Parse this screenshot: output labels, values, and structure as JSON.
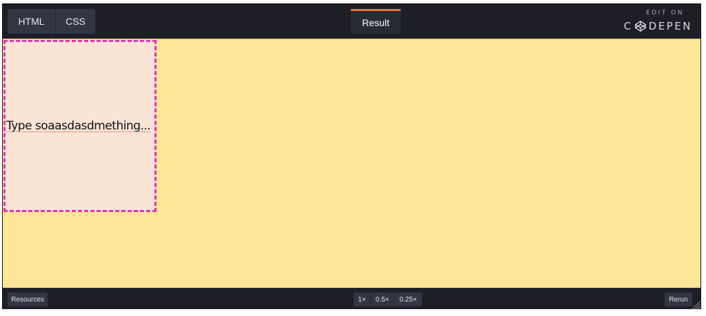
{
  "header": {
    "tabs": [
      {
        "label": "HTML"
      },
      {
        "label": "CSS"
      }
    ],
    "result_tab": "Result",
    "logo": {
      "edit_on": "EDIT ON",
      "wordmark_prefix": "C",
      "wordmark_suffix": "DEPEN"
    }
  },
  "result": {
    "editable_text": "Type soaasdasdmething...",
    "colors": {
      "background": "#ffe598",
      "box_fill": "#f9e4d6",
      "box_border": "#e632b4"
    }
  },
  "footer": {
    "resources_label": "Resources",
    "zoom_options": [
      "1×",
      "0.5×",
      "0.25×"
    ],
    "rerun_label": "Rerun"
  },
  "icons": {
    "logo": "codepen-logo-icon",
    "grip": "resize-grip-icon"
  }
}
